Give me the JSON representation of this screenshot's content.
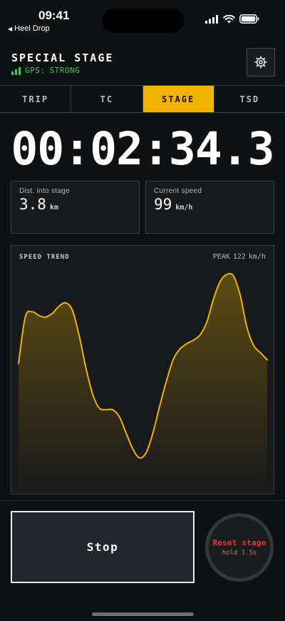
{
  "status_bar": {
    "time": "09:41",
    "back_label": "Heel Drop",
    "icons": [
      "cellular-signal-icon",
      "wifi-icon",
      "battery-icon"
    ]
  },
  "header": {
    "title": "SPECIAL STAGE",
    "gps_label": "GPS:",
    "gps_status": "STRONG",
    "gps_bars_filled": 3,
    "settings_icon": "gear-icon"
  },
  "tabs": [
    {
      "label": "TRIP",
      "active": false
    },
    {
      "label": "TC",
      "active": false
    },
    {
      "label": "STAGE",
      "active": true
    },
    {
      "label": "TSD",
      "active": false
    }
  ],
  "timer": "00:02:34.3",
  "stats": {
    "distance": {
      "label": "Dist. into stage",
      "value": "3.8",
      "unit": "km"
    },
    "speed": {
      "label": "Current speed",
      "value": "99",
      "unit": "km/h"
    }
  },
  "trend": {
    "title": "SPEED TREND",
    "peak_label": "PEAK",
    "peak_value": "122",
    "peak_unit": "km/h"
  },
  "actions": {
    "stop_label": "Stop",
    "reset_label": "Reset stage",
    "reset_hint": "hold 1.5s"
  },
  "colors": {
    "accent": "#f0b400",
    "gps_ok": "#3ec45a",
    "danger": "#e0383b",
    "background": "#0f1011"
  },
  "chart_data": {
    "type": "area",
    "values": [
      72,
      98,
      101,
      99,
      98,
      100,
      104,
      106,
      102,
      88,
      70,
      55,
      47,
      46,
      46,
      42,
      33,
      24,
      19,
      22,
      33,
      48,
      62,
      74,
      80,
      83,
      85,
      88,
      95,
      108,
      118,
      122,
      121,
      110,
      92,
      82,
      78,
      74
    ],
    "ylim": [
      0,
      130
    ],
    "title": "SPEED TREND",
    "peak": 122
  }
}
